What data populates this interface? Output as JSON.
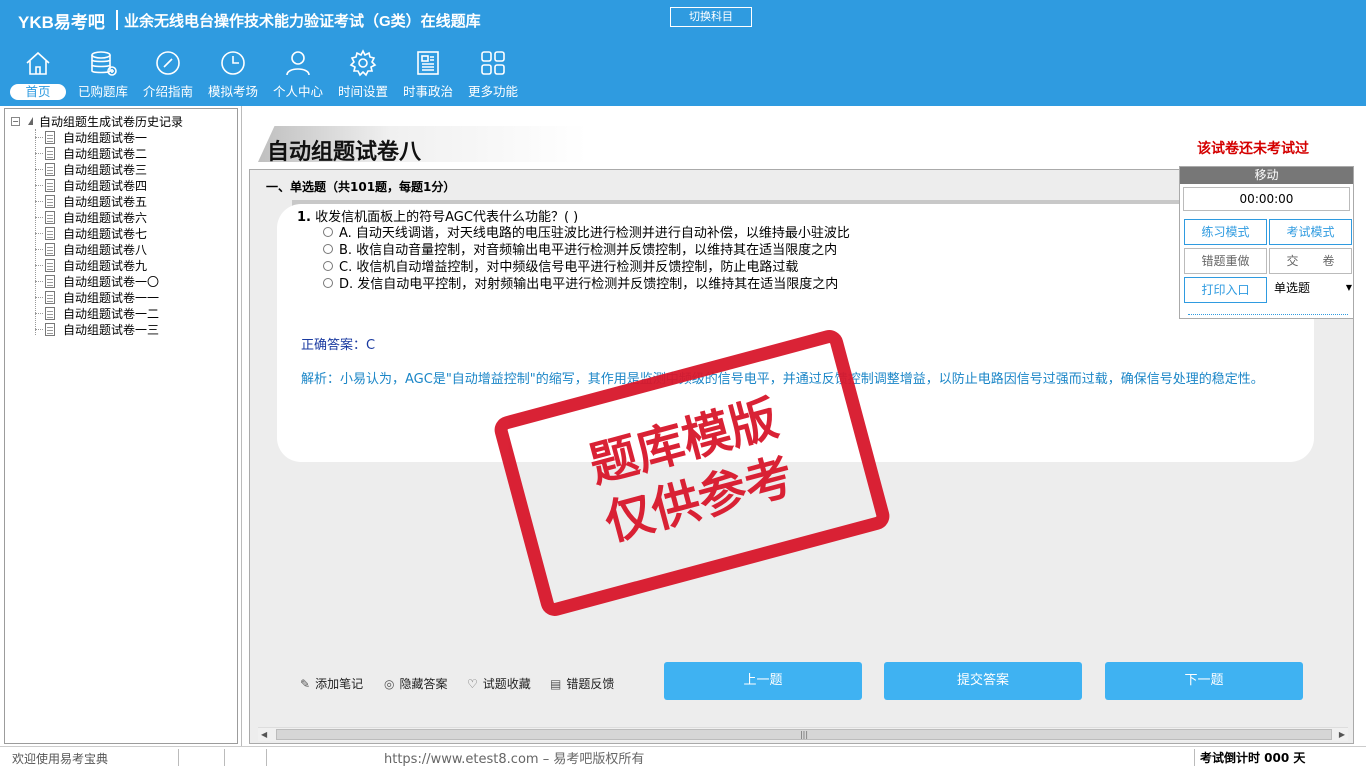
{
  "header": {
    "logo": "YKB易考吧",
    "title": "业余无线电台操作技术能力验证考试（G类）在线题库",
    "switch_label": "切换科目"
  },
  "nav": [
    {
      "label": "首页",
      "icon": "home-icon"
    },
    {
      "label": "已购题库",
      "icon": "database-icon"
    },
    {
      "label": "介绍指南",
      "icon": "compass-icon"
    },
    {
      "label": "模拟考场",
      "icon": "clock-icon"
    },
    {
      "label": "个人中心",
      "icon": "user-icon"
    },
    {
      "label": "时间设置",
      "icon": "gear-icon"
    },
    {
      "label": "时事政治",
      "icon": "newspaper-icon"
    },
    {
      "label": "更多功能",
      "icon": "grid-icon"
    }
  ],
  "tree": {
    "root": "自动组题生成试卷历史记录",
    "items": [
      "自动组题试卷一",
      "自动组题试卷二",
      "自动组题试卷三",
      "自动组题试卷四",
      "自动组题试卷五",
      "自动组题试卷六",
      "自动组题试卷七",
      "自动组题试卷八",
      "自动组题试卷九",
      "自动组题试卷一〇",
      "自动组题试卷一一",
      "自动组题试卷一二",
      "自动组题试卷一三"
    ]
  },
  "paper": {
    "title": "自动组题试卷八",
    "status": "该试卷还未考试过",
    "section": "一、单选题（共101题，每题1分）"
  },
  "question": {
    "number": "1.",
    "stem": "收发信机面板上的符号AGC代表什么功能？( )",
    "options": [
      "A. 自动天线调谐，对天线电路的电压驻波比进行检测并进行自动补偿，以维持最小驻波比",
      "B. 收信自动音量控制，对音频输出电平进行检测并反馈控制，以维持其在适当限度之内",
      "C. 收信机自动增益控制，对中频级信号电平进行检测并反馈控制，防止电路过载",
      "D. 发信自动电平控制，对射频输出电平进行检测并反馈控制，以维持其在适当限度之内"
    ],
    "correct_label": "正确答案：C",
    "analysis": "解析：小易认为，AGC是\"自动增益控制\"的缩写，其作用是监测中频级的信号电平，并通过反馈控制调整增益，以防止电路因信号过强而过载，确保信号处理的稳定性。"
  },
  "stamp": {
    "line1": "题库模版",
    "line2": "仅供参考"
  },
  "tools": {
    "note": "添加笔记",
    "hide": "隐藏答案",
    "fav": "试题收藏",
    "feedback": "错题反馈"
  },
  "buttons": {
    "prev": "上一题",
    "submit": "提交答案",
    "next": "下一题"
  },
  "timer_panel": {
    "header": "移动",
    "time": "00:00:00",
    "practice": "练习模式",
    "exam": "考试模式",
    "redo": "错题重做",
    "hand_in": "交　　卷",
    "print": "打印入口",
    "type_selected": "单选题"
  },
  "status": {
    "left": "欢迎使用易考宝典",
    "center": "https://www.etest8.com – 易考吧版权所有",
    "right": "考试倒计时 000 天"
  },
  "colors": {
    "brand": "#2f9be0",
    "stamp": "#d8172b",
    "status_red": "#d40000",
    "button": "#3fb2f2"
  }
}
